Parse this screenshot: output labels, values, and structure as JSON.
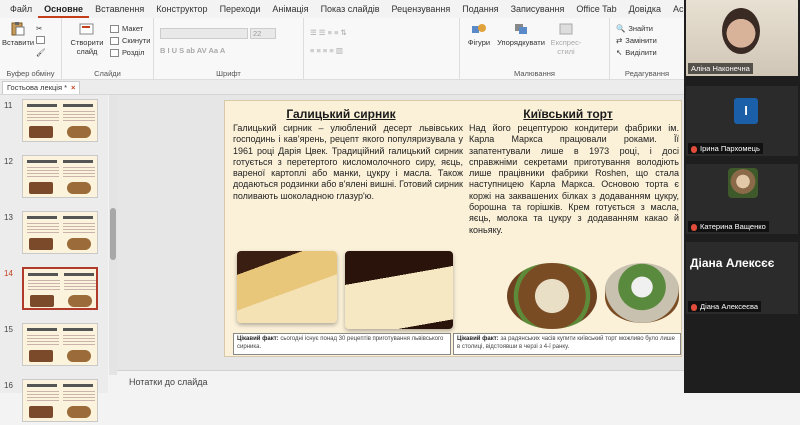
{
  "menu": {
    "tabs": [
      "Файл",
      "Основне",
      "Вставлення",
      "Конструктор",
      "Переходи",
      "Анімація",
      "Показ слайдів",
      "Рецензування",
      "Подання",
      "Записування",
      "Office Tab",
      "Довідка",
      "Acrob"
    ],
    "active": "Основне"
  },
  "ribbon": {
    "paste": "Вставити",
    "clipboard": "Буфер обміну",
    "new_slide": "Створити слайд",
    "layout": "Макет",
    "reset": "Скинути",
    "section": "Розділ",
    "slides": "Слайди",
    "font_size": "22",
    "font": "Шрифт",
    "shapes": "Фігури",
    "arrange": "Упорядкувати",
    "quick_styles": "Експрес-стилі",
    "drawing": "Малювання",
    "find": "Знайти",
    "replace": "Замінити",
    "select": "Виділити",
    "editing": "Редагування"
  },
  "doc_tab": {
    "name": "Гостьова лекція *",
    "close": "×"
  },
  "thumbnails": [
    {
      "num": "11",
      "selected": false
    },
    {
      "num": "12",
      "selected": false
    },
    {
      "num": "13",
      "selected": false
    },
    {
      "num": "14",
      "selected": true
    },
    {
      "num": "15",
      "selected": false
    },
    {
      "num": "16",
      "selected": false
    }
  ],
  "slide": {
    "left_title": "Галицький сирник",
    "left_text": "Галицький сирник – улюблений десерт львівських господинь і кав’ярень, рецепт якого популяризувала у 1961 році Дарія Цвек. Традиційний галицький сирник готується з перетертого кисломолочного сиру, яєць, вареної картоплі або манки, цукру і масла. Також додаються родзинки або в'ялені вишні. Готовий сирник поливають шоколадною глазур'ю.",
    "right_title": "Київський торт",
    "right_text": "Над його рецептурою кондитери фабрики ім. Карла Маркса працювали роками. Її запатентували лише в 1973 році, і досі справжніми секретами приготування володіють лише працівники фабрики Roshen, що стала наступницею Карла Маркса. Основою торта є коржі на заквашених білках з додаванням цукру, борошна та горішків. Крем готується з масла, яєць, молока та цукру з додаванням какао й коньяку.",
    "left_fact_label": "Цікавий факт:",
    "left_fact": "сьогодні існує понад 30 рецептів приготування львівського сирника.",
    "right_fact_label": "Цікавий факт:",
    "right_fact": "за радянських часів купити київський торт можливо було лише в столиці, відстоявши в черзі з 4-ї ранку."
  },
  "notes": {
    "placeholder": "Нотатки до слайда"
  },
  "participants": [
    {
      "name": "Аліна Наконечна",
      "type": "video"
    },
    {
      "name": "Ірина Пархомець",
      "type": "initial",
      "initial": "I"
    },
    {
      "name": "Катерина Ващенко",
      "type": "photo"
    },
    {
      "name": "Діана Алексеєва",
      "type": "bigname",
      "big": "Діана Алексєє"
    }
  ],
  "colors": {
    "accent": "#c43e1c",
    "slide_bg": "#fbf1d9",
    "avatar_blue": "#1a5fa8"
  }
}
